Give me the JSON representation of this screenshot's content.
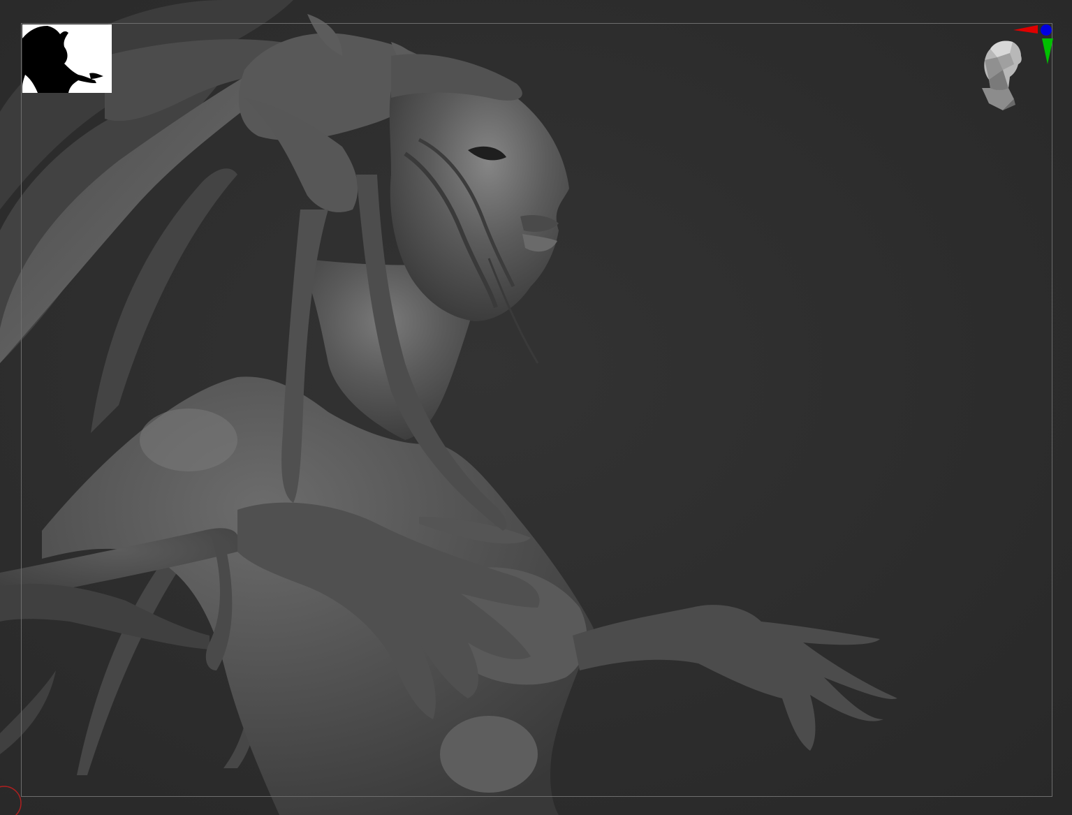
{
  "app": {
    "background_color": "#2c2c2c",
    "frame_color": "#6e6e6e"
  },
  "viewport": {
    "subject": "sculpt-model",
    "material_color": "#5a5a5a"
  },
  "thumbnail": {
    "icon": "silhouette-icon",
    "background": "#ffffff"
  },
  "navigator": {
    "icon": "head-navigator-icon",
    "axis_x_color": "#e00000",
    "axis_y_color": "#00c000",
    "axis_z_color": "#0000e0"
  },
  "cursor": {
    "icon": "brush-cursor-icon",
    "color": "#b02020"
  }
}
